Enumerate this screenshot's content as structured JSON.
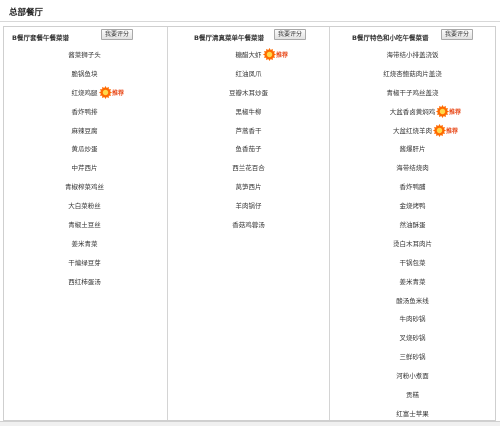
{
  "page": {
    "title": "总部餐厅"
  },
  "recommend_label": "推荐",
  "accent_color": "#ff6a00",
  "rate_label": "我要评分",
  "columns": [
    {
      "title": "B餐厅套餐午餐菜谱",
      "items": [
        {
          "name": "酱菜狮子头"
        },
        {
          "name": "脆锅鱼块"
        },
        {
          "name": "红烧鸡腿",
          "recommended": true
        },
        {
          "name": "香炸鸭排"
        },
        {
          "name": "麻辣豆腐"
        },
        {
          "name": "黄瓜炒蛋"
        },
        {
          "name": "中芹西片"
        },
        {
          "name": "青椒榨菜鸡丝"
        },
        {
          "name": "大白菜粉丝"
        },
        {
          "name": "青椒土豆丝"
        },
        {
          "name": "姜米青菜"
        },
        {
          "name": "干煸绿豆芽"
        },
        {
          "name": "西红柿蛋汤"
        }
      ]
    },
    {
      "title": "B餐厅清真菜单午餐菜谱",
      "items": [
        {
          "name": "糖醋大虾",
          "recommended": true
        },
        {
          "name": "红油凤爪"
        },
        {
          "name": "豆瓣木耳炒蛋"
        },
        {
          "name": "黑椒牛柳"
        },
        {
          "name": "芦蒿香干"
        },
        {
          "name": "鱼香茄子"
        },
        {
          "name": "西兰花百合"
        },
        {
          "name": "莴笋西片"
        },
        {
          "name": "羊肉锅仔"
        },
        {
          "name": "香菇鸡蓉汤"
        }
      ]
    },
    {
      "title": "B餐厅特色和小吃午餐菜谱",
      "items": [
        {
          "name": "海带结小排盖浇饭"
        },
        {
          "name": "红烧杏鲍菇肉片盖浇"
        },
        {
          "name": "青椒干子鸡丝盖浇"
        },
        {
          "name": "大盆香卤黄焖鸡",
          "recommended": true
        },
        {
          "name": "大盆红烧羊肉",
          "recommended": true
        },
        {
          "name": "酱爆肝片"
        },
        {
          "name": "海带结烧肉"
        },
        {
          "name": "香炸鸭脯"
        },
        {
          "name": "金烧烤鸭"
        },
        {
          "name": "然油酥蛋"
        },
        {
          "name": "烫白木耳肉片"
        },
        {
          "name": "干锅包菜"
        },
        {
          "name": "姜米青菜"
        },
        {
          "name": "酸汤鱼米线"
        },
        {
          "name": "牛肉砂锅"
        },
        {
          "name": "叉烧砂锅"
        },
        {
          "name": "三鲜砂锅"
        },
        {
          "name": "河粉小煮面"
        },
        {
          "name": "贡糕"
        },
        {
          "name": "红富士苹果"
        }
      ]
    }
  ]
}
